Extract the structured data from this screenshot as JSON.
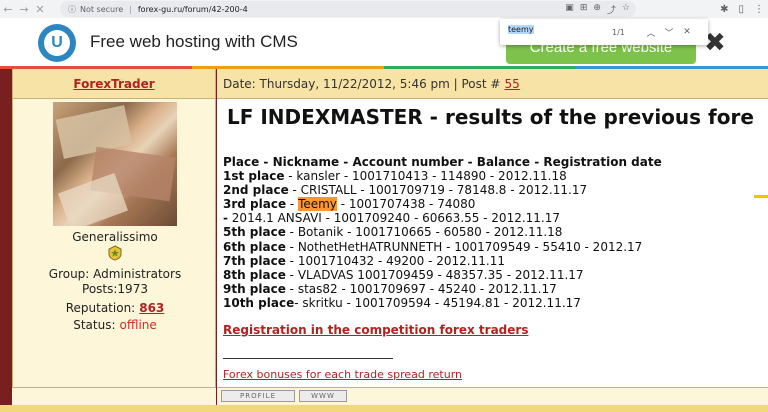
{
  "browser": {
    "security_label": "Not secure",
    "url": "forex-gu.ru/forum/42-200-4"
  },
  "find_bar": {
    "query": "teemy",
    "count": "1/1",
    "prev_icon": "chevron-up-icon",
    "next_icon": "chevron-down-icon",
    "close_icon": "close-icon"
  },
  "ad": {
    "logo_letter": "U",
    "headline": "Free web hosting with CMS",
    "cta": "Create a free website",
    "close": "✖"
  },
  "post": {
    "author": "ForexTrader",
    "date_text": "Date: Thursday, 11/22/2012, 5:46 pm | Post #",
    "post_number": "55",
    "title": "LF INDEXMASTER - results of the previous fore",
    "header_line": "Place - Nickname - Account number - Balance - Registration date",
    "results": [
      {
        "place": "1st place",
        "text": " - kansler - 1001710413 - 114890 - 2012.11.18"
      },
      {
        "place": "2nd place",
        "text": " - CRISTALL - 1001709719 - 78148.8 - 2012.11.17"
      },
      {
        "place": "3rd place",
        "text_before": " - ",
        "highlight": "Teemy",
        "text_after": " - 1001707438 - 74080"
      },
      {
        "place": "-",
        "text": " 2014.1 ANSAVI - 1001709240 - 60663.55 - 2012.11.17"
      },
      {
        "place": "5th place",
        "text": " - Botanik - 1001710665 - 60580 - 2012.11.18"
      },
      {
        "place": "6th place",
        "text": " - NothetHetHATRUNNETH - 1001709549 - 55410 - 2012.17"
      },
      {
        "place": "7th place",
        "text": " - 1001710432 - 49200 - 2012.11.11"
      },
      {
        "place": "8th place",
        "text": " - VLADVAS 1001709459 - 48357.35 - 2012.11.17"
      },
      {
        "place": "9th place",
        "text": " - stas82 - 1001709697 - 45240 - 2012.11.17"
      },
      {
        "place": "10th place",
        "text": "- skritku - 1001709594 - 45194.81 - 2012.11.17"
      }
    ],
    "competition_link": "Registration in the competition forex traders",
    "bonus_link": "Forex bonuses for each trade spread return"
  },
  "profile": {
    "rank": "Generalissimo",
    "group": "Group: Administrators",
    "posts": "Posts:1973",
    "reputation_label": "Reputation:",
    "reputation_value": "863",
    "status_label": "Status:",
    "status_value": "offline",
    "profile_button": "PROFILE",
    "www_button": "WWW"
  },
  "colors": {
    "forum_header": "#f7e3a6",
    "link_red": "#b22222",
    "highlight": "#ff9632",
    "ad_button": "#7dc24b"
  }
}
